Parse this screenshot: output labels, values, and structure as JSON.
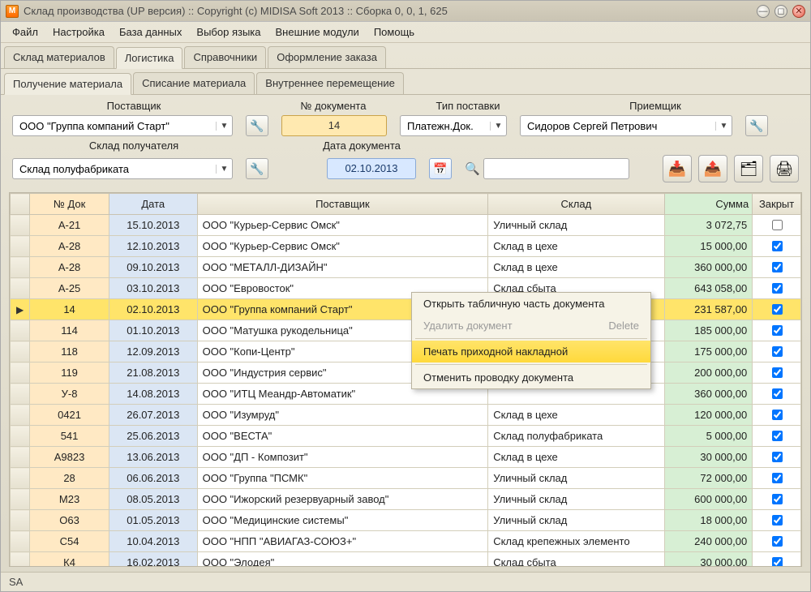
{
  "window_title": "Склад производства (UP версия) :: Copyright (c) MIDISA Soft 2013 :: Сборка 0, 0, 1, 625",
  "menu": [
    "Файл",
    "Настройка",
    "База данных",
    "Выбор языка",
    "Внешние модули",
    "Помощь"
  ],
  "tabs1": [
    "Склад материалов",
    "Логистика",
    "Справочники",
    "Оформление заказа"
  ],
  "tabs1_active": 1,
  "tabs2": [
    "Получение материала",
    "Списание материала",
    "Внутреннее перемещение"
  ],
  "tabs2_active": 0,
  "filters": {
    "labels": {
      "supplier": "Поставщик",
      "docnum": "№ документа",
      "type": "Тип поставки",
      "receiver": "Приемщик",
      "store": "Склад получателя",
      "docdate": "Дата документа"
    },
    "supplier": "ООО \"Группа компаний Старт\"",
    "docnum": "14",
    "type": "Платежн.Док.",
    "receiver": "Сидоров Сергей Петрович",
    "store": "Склад полуфабриката",
    "docdate": "02.10.2013"
  },
  "grid": {
    "headers": [
      "№ Док",
      "Дата",
      "Поставщик",
      "Склад",
      "Сумма",
      "Закрыт"
    ],
    "rows": [
      {
        "doc": "А-21",
        "date": "15.10.2013",
        "supp": "ООО \"Курьер-Сервис Омск\"",
        "store": "Уличный склад",
        "sum": "3 072,75",
        "closed": false
      },
      {
        "doc": "А-28",
        "date": "12.10.2013",
        "supp": "ООО \"Курьер-Сервис Омск\"",
        "store": "Склад в цехе",
        "sum": "15 000,00",
        "closed": true
      },
      {
        "doc": "А-28",
        "date": "09.10.2013",
        "supp": "ООО \"МЕТАЛЛ-ДИЗАЙН\"",
        "store": "Склад в цехе",
        "sum": "360 000,00",
        "closed": true
      },
      {
        "doc": "А-25",
        "date": "03.10.2013",
        "supp": "ООО \"Евровосток\"",
        "store": "Склад сбыта",
        "sum": "643 058,00",
        "closed": true
      },
      {
        "doc": "14",
        "date": "02.10.2013",
        "supp": "ООО \"Группа компаний Старт\"",
        "store": "",
        "sum": "231 587,00",
        "closed": true,
        "selected": true
      },
      {
        "doc": "114",
        "date": "01.10.2013",
        "supp": "ООО \"Матушка рукодельница\"",
        "store": "",
        "sum": "185 000,00",
        "closed": true
      },
      {
        "doc": "118",
        "date": "12.09.2013",
        "supp": "ООО \"Копи-Центр\"",
        "store": "",
        "sum": "175 000,00",
        "closed": true
      },
      {
        "doc": "119",
        "date": "21.08.2013",
        "supp": "ООО \"Индустрия сервис\"",
        "store": "",
        "sum": "200 000,00",
        "closed": true
      },
      {
        "doc": "У-8",
        "date": "14.08.2013",
        "supp": "ООО \"ИТЦ Меандр-Автоматик\"",
        "store": "",
        "sum": "360 000,00",
        "closed": true
      },
      {
        "doc": "0421",
        "date": "26.07.2013",
        "supp": "ООО \"Изумруд\"",
        "store": "Склад в цехе",
        "sum": "120 000,00",
        "closed": true
      },
      {
        "doc": "541",
        "date": "25.06.2013",
        "supp": "ООО \"ВЕСТА\"",
        "store": "Склад полуфабриката",
        "sum": "5 000,00",
        "closed": true
      },
      {
        "doc": "А9823",
        "date": "13.06.2013",
        "supp": "ООО \"ДП - Композит\"",
        "store": "Склад в цехе",
        "sum": "30 000,00",
        "closed": true
      },
      {
        "doc": "28",
        "date": "06.06.2013",
        "supp": "ООО \"Группа \"ПСМК\"",
        "store": "Уличный склад",
        "sum": "72 000,00",
        "closed": true
      },
      {
        "doc": "М23",
        "date": "08.05.2013",
        "supp": "ООО \"Ижорский резервуарный завод\"",
        "store": "Уличный склад",
        "sum": "600 000,00",
        "closed": true
      },
      {
        "doc": "О63",
        "date": "01.05.2013",
        "supp": "ООО \"Медицинские системы\"",
        "store": "Уличный склад",
        "sum": "18 000,00",
        "closed": true
      },
      {
        "doc": "С54",
        "date": "10.04.2013",
        "supp": "ООО \"НПП \"АВИАГАЗ-СОЮЗ+\"",
        "store": "Склад крепежных элементо",
        "sum": "240 000,00",
        "closed": true
      },
      {
        "doc": "К4",
        "date": "16.02.2013",
        "supp": "ООО \"Элодея\"",
        "store": "Склад сбыта",
        "sum": "30 000,00",
        "closed": true
      }
    ]
  },
  "context_menu": {
    "items": [
      {
        "label": "Открыть табличную часть документа",
        "enabled": true
      },
      {
        "label": "Удалить документ",
        "short": "Delete",
        "enabled": false
      },
      {
        "label": "Печать приходной накладной",
        "enabled": true,
        "hover": true,
        "sep_before": true
      },
      {
        "label": "Отменить проводку документа",
        "enabled": true,
        "sep_before": true
      }
    ]
  },
  "status": "SA"
}
